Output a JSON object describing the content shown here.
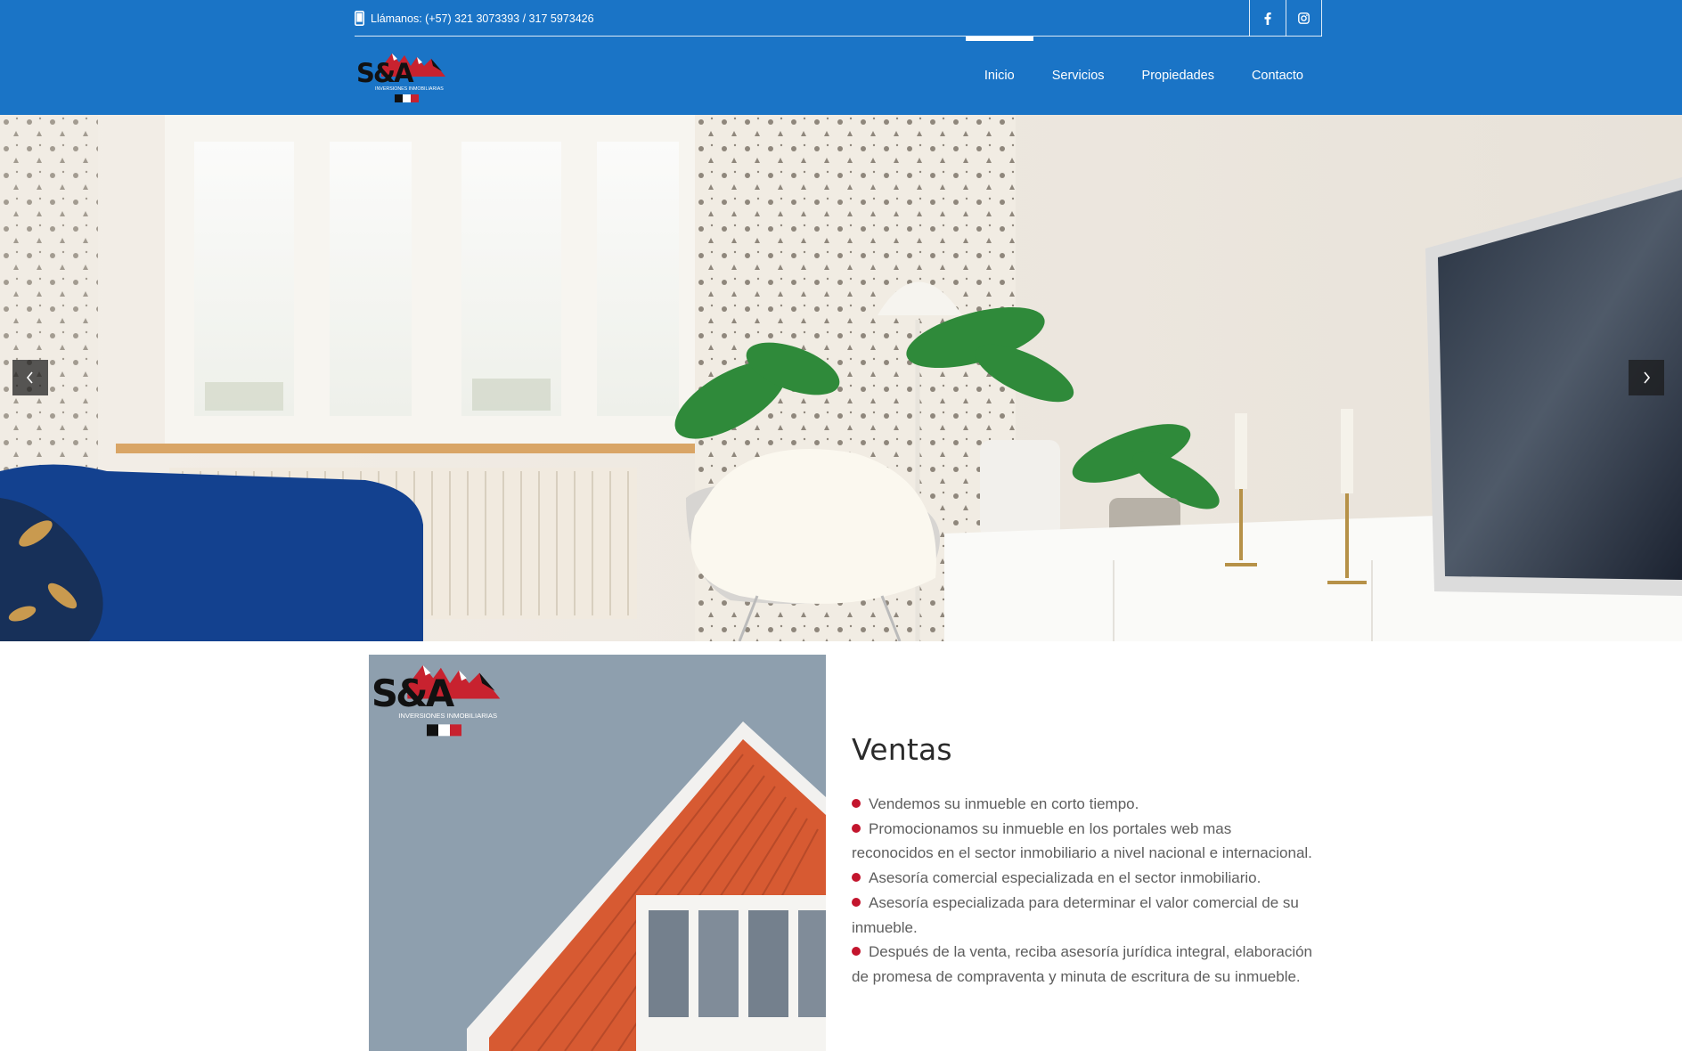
{
  "topbar": {
    "phone_text": "Llámanos: (+57) 321 3073393 / 317 5973426",
    "social": [
      {
        "icon": "facebook-icon",
        "label": "f"
      },
      {
        "icon": "instagram-icon",
        "label": ""
      }
    ]
  },
  "logo": {
    "letters": "S&A",
    "tagline": "INVERSIONES INMOBILIARIAS"
  },
  "nav": {
    "items": [
      {
        "label": "Inicio",
        "active": true
      },
      {
        "label": "Servicios",
        "active": false
      },
      {
        "label": "Propiedades",
        "active": false
      },
      {
        "label": "Contacto",
        "active": false
      }
    ]
  },
  "hero": {
    "prev_icon": "chevron-left-icon",
    "next_icon": "chevron-right-icon"
  },
  "section": {
    "title": "Ventas",
    "items": [
      "Vendemos su inmueble en corto tiempo.",
      "Promocionamos su inmueble en los portales web mas reconocidos en el sector inmobiliario a nivel nacional e internacional.",
      "Asesoría comercial especializada en el sector inmobiliario.",
      "Asesoría especializada para determinar el valor comercial de su inmueble.",
      "Después de la venta, reciba asesoría jurídica integral, elaboración de promesa de compraventa y minuta de escritura de su inmueble."
    ]
  },
  "colors": {
    "header_blue": "#1a74c6",
    "bullet_red": "#c3152d"
  }
}
